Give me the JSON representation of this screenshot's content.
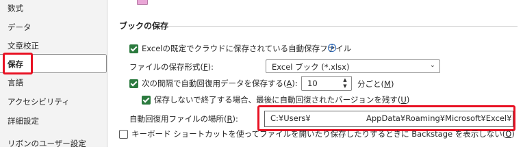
{
  "sidebar": {
    "items": [
      {
        "label": "数式"
      },
      {
        "label": "データ"
      },
      {
        "label": "文章校正"
      },
      {
        "label": "保存"
      },
      {
        "label": "言語"
      },
      {
        "label": "アクセシビリティ"
      },
      {
        "label": "詳細設定"
      },
      {
        "label": "リボンのユーザー設定"
      }
    ],
    "selected": "保存"
  },
  "main": {
    "section_title": "ブックの保存",
    "autosave_label": "Excelの既定でクラウドに保存されている自動保存ファイル",
    "autosave_checked": true,
    "info_icon": "info-icon",
    "format_label": "ファイルの保存形式(",
    "format_key": "F",
    "format_suffix": "):",
    "format_value": "Excel ブック (*.xlsx)",
    "autorecover_label": "次の間隔で自動回復用データを保存する(",
    "autorecover_key": "A",
    "autorecover_suffix": "):",
    "autorecover_checked": true,
    "interval_value": "10",
    "interval_unit": "分ごと(",
    "interval_key": "M",
    "interval_suffix": ")",
    "keep_last_label": "保存しないで終了する場合、最後に自動回復されたバージョンを残す(",
    "keep_last_key": "U",
    "keep_last_suffix": ")",
    "keep_last_checked": true,
    "location_label": "自動回復用ファイルの場所(",
    "location_key": "R",
    "location_suffix": "):",
    "location_value_start": "C:¥Users¥",
    "location_value_end": "AppData¥Roaming¥Microsoft¥Excel¥",
    "shortcut_label": "キーボード ショートカットを使ってファイルを開いたり保存したりするときに Backstage を表示しない(",
    "shortcut_key": "O",
    "shortcut_suffix": ")",
    "shortcut_checked": false
  },
  "colors": {
    "highlight": "#e81123",
    "checkbox": "#2b7a3e"
  }
}
